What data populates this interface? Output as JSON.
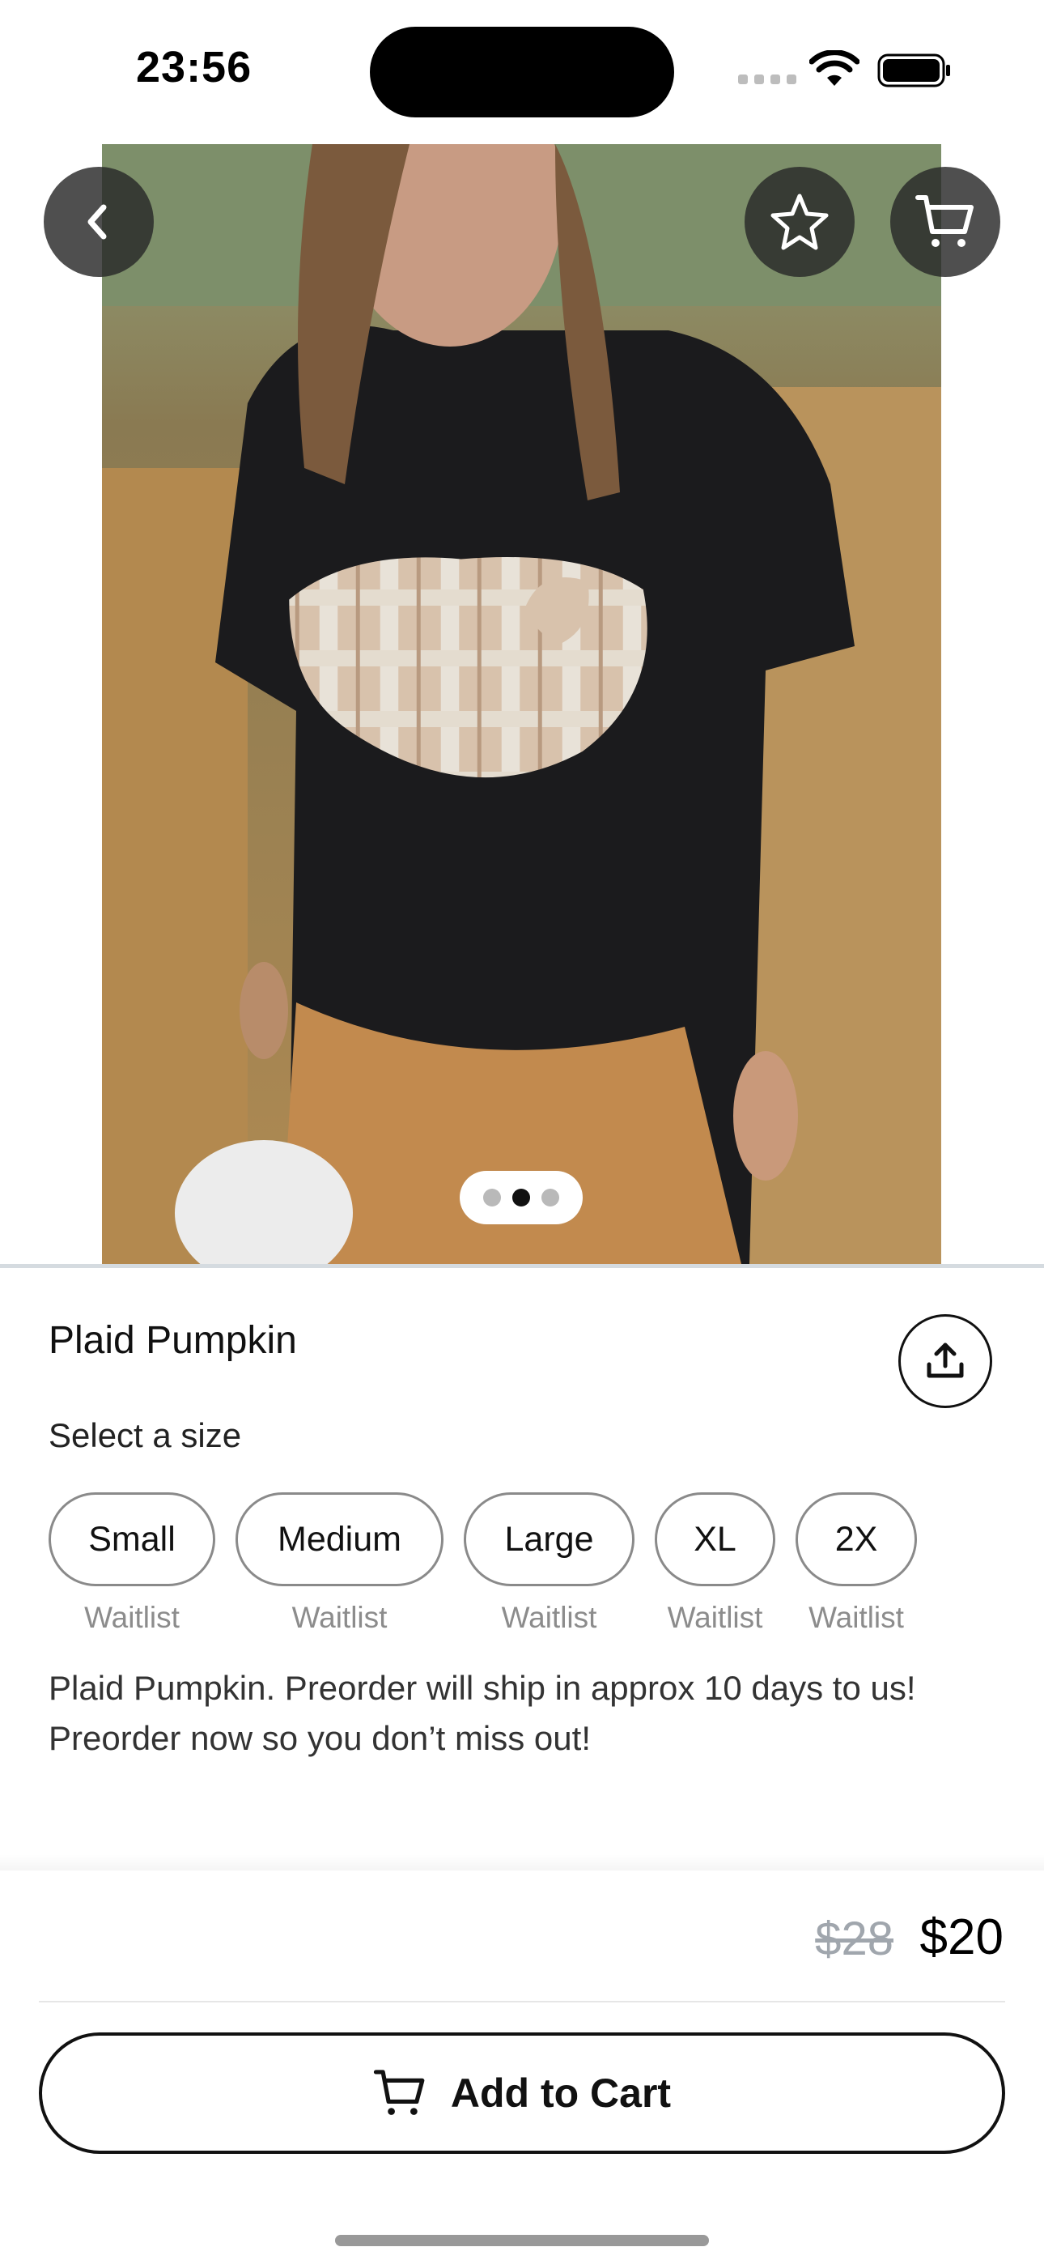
{
  "status_bar": {
    "time": "23:56"
  },
  "product": {
    "title": "Plaid Pumpkin",
    "select_size_label": "Select a size",
    "sizes": [
      {
        "label": "Small",
        "status": "Waitlist"
      },
      {
        "label": "Medium",
        "status": "Waitlist"
      },
      {
        "label": "Large",
        "status": "Waitlist"
      },
      {
        "label": "XL",
        "status": "Waitlist"
      },
      {
        "label": "2X",
        "status": "Waitlist"
      }
    ],
    "description": "Plaid Pumpkin. Preorder will ship in approx 10 days to us! Preorder now so you don’t miss out!",
    "old_price": "$28",
    "price": "$20"
  },
  "gallery": {
    "image_count": 3,
    "active_index": 1
  },
  "actions": {
    "add_to_cart": "Add to Cart"
  },
  "icons": {
    "back": "chevron-left-icon",
    "favorite": "star-icon",
    "cart": "cart-icon",
    "share": "share-icon"
  },
  "colors": {
    "overlay_button": "#282828",
    "accent": "#111111",
    "muted": "#8c8c8c"
  }
}
